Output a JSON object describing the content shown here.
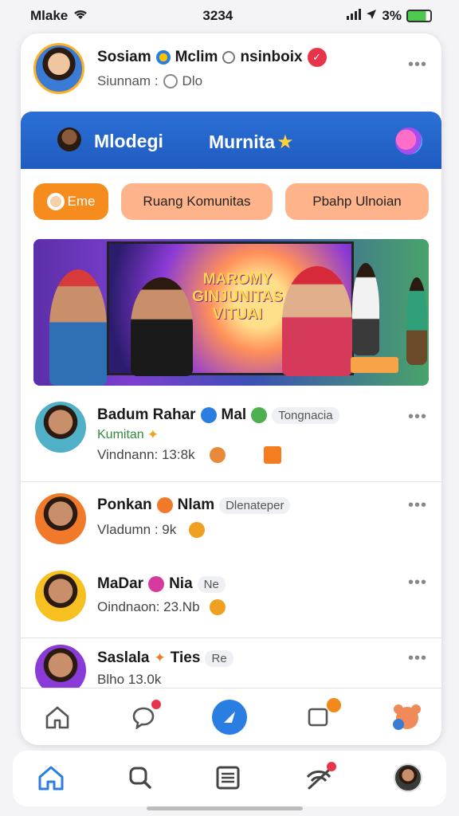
{
  "status_bar": {
    "left": "Mlake",
    "time": "3234",
    "battery": "3%"
  },
  "profile": {
    "name": "Sosiam",
    "name_suffix": "Mclim",
    "handle": "nsinboix",
    "sub_label": "Siunnam :",
    "sub_value": "Dlo"
  },
  "header": {
    "tab1": "Mlodegi",
    "tab2": "Murnita"
  },
  "chips": [
    "Eme",
    "Ruang Komunitas",
    "Pbahp Ulnoian"
  ],
  "banner": {
    "headline": "MAROMY GINJUNITAS VITUAI"
  },
  "feed": [
    {
      "name": "Badum Rahar",
      "name2": "Mal",
      "tag": "Tongnacia",
      "sub": "Kumitan",
      "meta": "Vindnann: 13:8k"
    },
    {
      "name": "Ponkan",
      "name2": "Nlam",
      "tag": "Dlenateper",
      "sub": "",
      "meta": "Vladumn : 9k"
    },
    {
      "name": "MaDar",
      "name2": "Nia",
      "tag": "Ne",
      "sub": "",
      "meta": "Oindnaon: 23.Nb"
    },
    {
      "name": "Saslala",
      "name2": "Ties",
      "tag": "Re",
      "sub": "",
      "meta": "Blho 13.0k"
    }
  ],
  "colors": {
    "accent": "#2a7de1",
    "header_blue": "#1f5cc0",
    "chip_orange": "#f68b1e",
    "chip_peach": "#ffb38a"
  },
  "icons": {
    "inner_nav": [
      "home-outline-icon",
      "chat-bubble-icon",
      "compose-icon",
      "media-icon",
      "bear-icon"
    ],
    "bottom_nav": [
      "home-icon",
      "search-icon",
      "list-icon",
      "wifi-call-icon",
      "profile-avatar-icon"
    ]
  }
}
